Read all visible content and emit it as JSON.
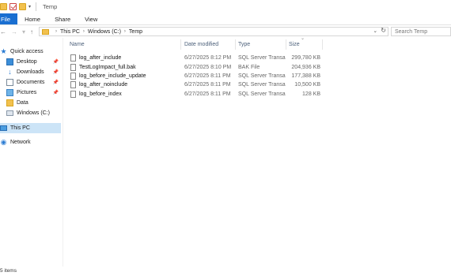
{
  "window": {
    "title": "Temp"
  },
  "ribbon": {
    "tabs": [
      "File",
      "Home",
      "Share",
      "View"
    ]
  },
  "address": {
    "crumbs": [
      "This PC",
      "Windows (C:)",
      "Temp"
    ],
    "search_placeholder": "Search Temp"
  },
  "nav": {
    "quick_access": "Quick access",
    "items": [
      {
        "label": "Desktop",
        "icon": "desktop-icon",
        "pinned": true
      },
      {
        "label": "Downloads",
        "icon": "downloads-icon",
        "pinned": true
      },
      {
        "label": "Documents",
        "icon": "documents-icon",
        "pinned": true
      },
      {
        "label": "Pictures",
        "icon": "pictures-icon",
        "pinned": true
      },
      {
        "label": "Data",
        "icon": "folder-icon",
        "pinned": false
      },
      {
        "label": "Windows (C:)",
        "icon": "drive-icon",
        "pinned": false
      }
    ],
    "this_pc": "This PC",
    "network": "Network"
  },
  "columns": {
    "name": "Name",
    "date": "Date modified",
    "type": "Type",
    "size": "Size"
  },
  "files": [
    {
      "name": "log_after_include",
      "date": "6/27/2025 8:12 PM",
      "type": "SQL Server Transa...",
      "size": "299,780 KB"
    },
    {
      "name": "TestLogImpact_full.bak",
      "date": "6/27/2025 8:10 PM",
      "type": "BAK File",
      "size": "204,936 KB"
    },
    {
      "name": "log_before_include_update",
      "date": "6/27/2025 8:11 PM",
      "type": "SQL Server Transa...",
      "size": "177,388 KB"
    },
    {
      "name": "log_after_noinclude",
      "date": "6/27/2025 8:11 PM",
      "type": "SQL Server Transa...",
      "size": "10,500 KB"
    },
    {
      "name": "log_before_index",
      "date": "6/27/2025 8:11 PM",
      "type": "SQL Server Transa...",
      "size": "128 KB"
    }
  ],
  "status": {
    "count": "5 items"
  },
  "colors": {
    "accent": "#1a6fd1",
    "selection": "#cce4f7",
    "header_text": "#4c607a"
  }
}
